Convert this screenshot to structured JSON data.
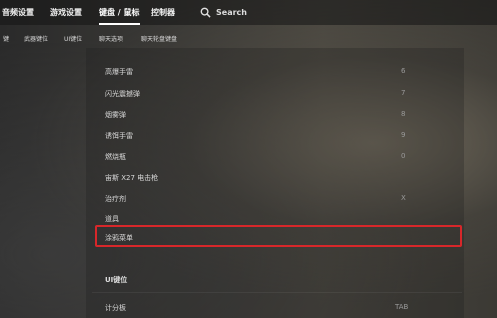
{
  "topnav": {
    "tabs": [
      {
        "label": "音频设置"
      },
      {
        "label": "游戏设置"
      },
      {
        "label": "键盘 / 鼠标"
      },
      {
        "label": "控制器"
      }
    ],
    "search_label": "Search"
  },
  "subnav": {
    "items": [
      {
        "label": "键"
      },
      {
        "label": "武器键位"
      },
      {
        "label": "UI键位"
      },
      {
        "label": "聊天选项"
      },
      {
        "label": "聊天轮盘键盘"
      }
    ]
  },
  "bindings": [
    {
      "label": "高爆手雷",
      "key": "6"
    },
    {
      "label": "闪光震撼弹",
      "key": "7"
    },
    {
      "label": "烟雾弹",
      "key": "8"
    },
    {
      "label": "诱饵手雷",
      "key": "9"
    },
    {
      "label": "燃烧瓶",
      "key": "0"
    },
    {
      "label": "宙斯 X27 电击枪",
      "key": ""
    },
    {
      "label": "治疗剂",
      "key": "X"
    },
    {
      "label": "道具",
      "key": ""
    },
    {
      "label": "涂鸦菜单",
      "key": ""
    }
  ],
  "ui_section": {
    "title": "UI键位",
    "rows": [
      {
        "label": "计分板",
        "key": "TAB"
      }
    ]
  },
  "colors": {
    "highlight_border": "#d8272a"
  }
}
